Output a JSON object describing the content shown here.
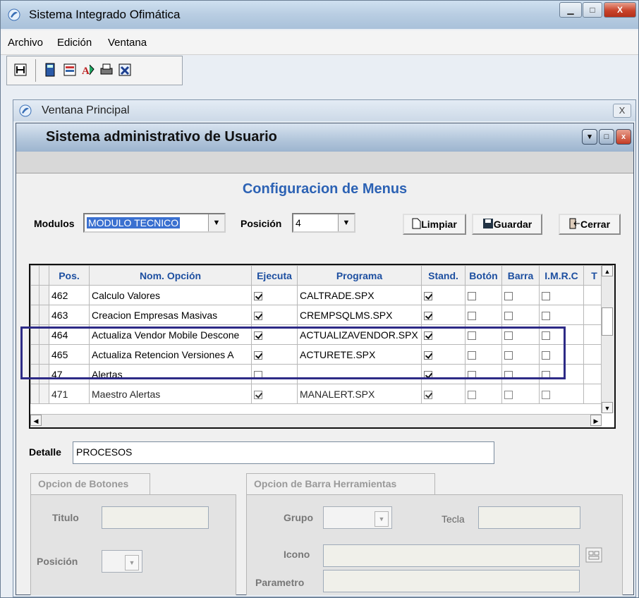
{
  "app": {
    "title": "Sistema Integrado Ofimática",
    "menu": [
      "Archivo",
      "Edición",
      "Ventana"
    ]
  },
  "child_window": {
    "title": "Ventana Principal",
    "close_label": "X"
  },
  "admin_window": {
    "title": "Sistema administrativo de Usuario"
  },
  "form": {
    "heading": "Configuracion de Menus",
    "modulos_label": "Modulos",
    "modulos_value": "MODULO TECNICO",
    "posicion_label": "Posición",
    "posicion_value": "4",
    "buttons": {
      "limpiar": "Limpiar",
      "guardar": "Guardar",
      "cerrar": "Cerrar"
    }
  },
  "grid": {
    "columns": [
      "Pos.",
      "Nom. Opción",
      "Ejecuta",
      "Programa",
      "Stand.",
      "Botón",
      "Barra",
      "I.M.R.C"
    ],
    "rows": [
      {
        "pos": "462",
        "nombre": "Calculo Valores",
        "ejecuta": true,
        "programa": "CALTRADE.SPX",
        "stand": true,
        "boton": false,
        "barra": false,
        "imrc": false
      },
      {
        "pos": "463",
        "nombre": "Creacion Empresas Masivas",
        "ejecuta": true,
        "programa": "CREMPSQLMS.SPX",
        "stand": true,
        "boton": false,
        "barra": false,
        "imrc": false
      },
      {
        "pos": "464",
        "nombre": "Actualiza Vendor Mobile Descone",
        "ejecuta": true,
        "programa": "ACTUALIZAVENDOR.SPX",
        "stand": true,
        "boton": false,
        "barra": false,
        "imrc": false
      },
      {
        "pos": "465",
        "nombre": "Actualiza Retencion Versiones A",
        "ejecuta": true,
        "programa": "ACTURETE.SPX",
        "stand": true,
        "boton": false,
        "barra": false,
        "imrc": false
      },
      {
        "pos": "47",
        "nombre": "Alertas",
        "ejecuta": false,
        "programa": "",
        "stand": true,
        "boton": false,
        "barra": false,
        "imrc": false
      },
      {
        "pos": "471",
        "nombre": "Maestro Alertas",
        "ejecuta": true,
        "programa": "MANALERT.SPX",
        "stand": true,
        "boton": false,
        "barra": false,
        "imrc": false
      }
    ]
  },
  "detalle": {
    "label": "Detalle",
    "value": "PROCESOS"
  },
  "tabs": {
    "botones": {
      "title": "Opcion de Botones",
      "titulo_label": "Titulo",
      "posicion_label": "Posición"
    },
    "barra": {
      "title": "Opcion de Barra Herramientas",
      "grupo_label": "Grupo",
      "tecla_label": "Tecla",
      "icono_label": "Icono",
      "parametro_label": "Parametro"
    }
  },
  "colors": {
    "accent": "#2c62b4",
    "highlight_border": "#2d2a86"
  }
}
